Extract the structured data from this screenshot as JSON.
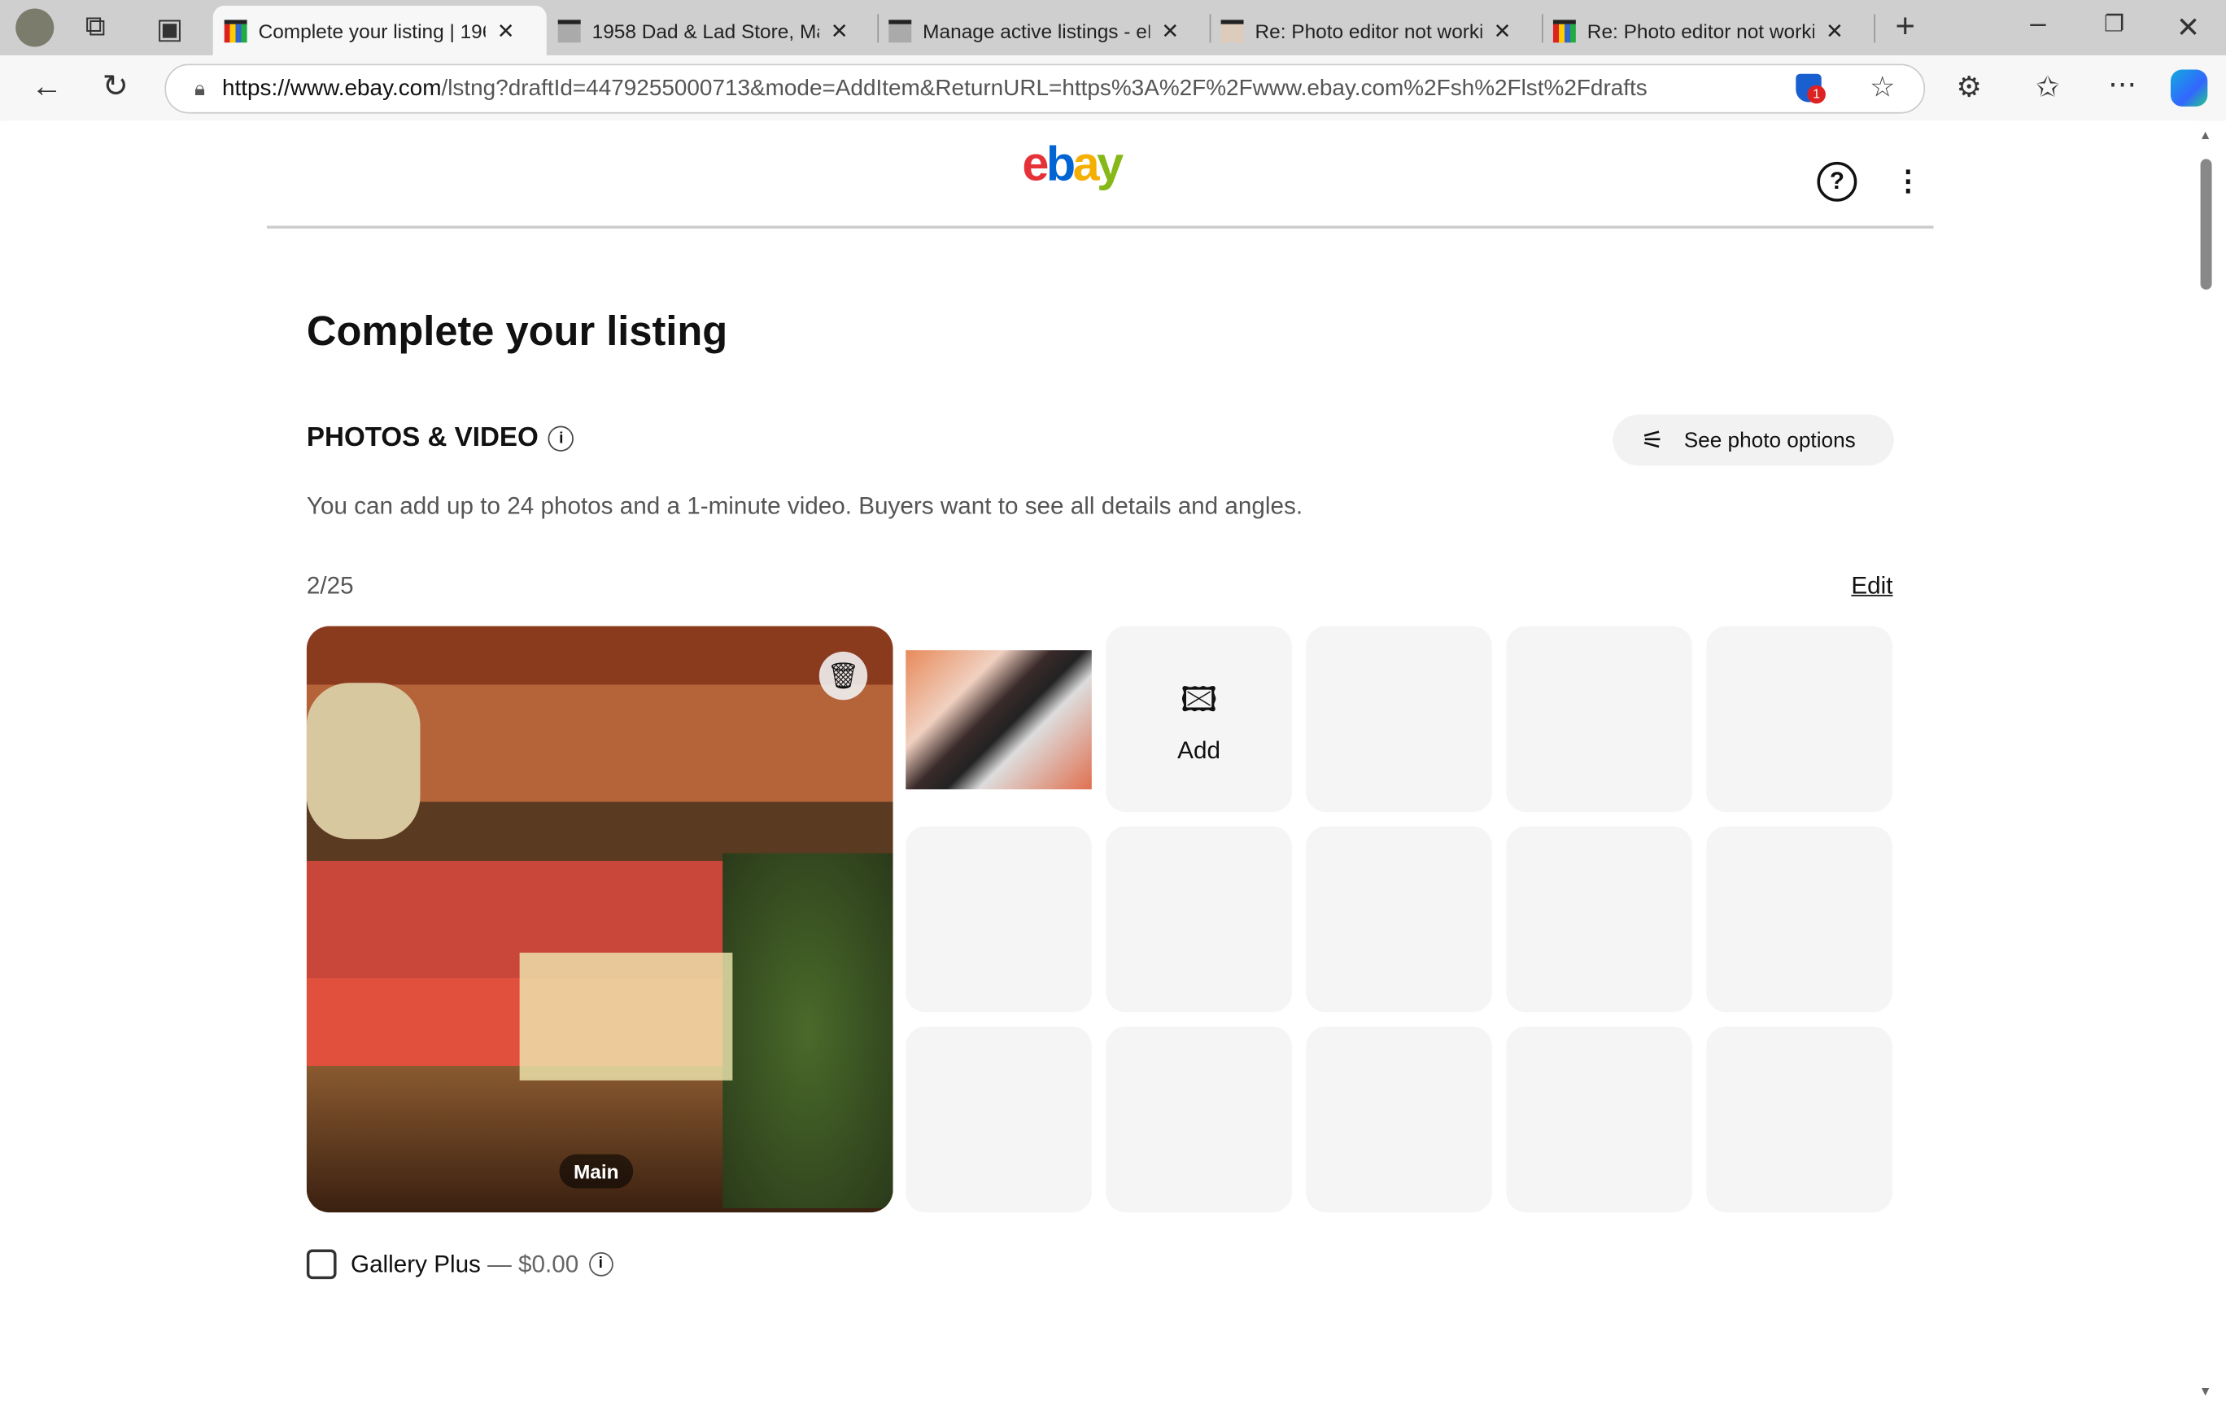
{
  "browser": {
    "tabs": [
      {
        "title": "Complete your listing | 196",
        "active": true
      },
      {
        "title": "1958 Dad & Lad Store, Mai",
        "active": false
      },
      {
        "title": "Manage active listings - eB",
        "active": false
      },
      {
        "title": "Re: Photo editor not workin",
        "active": false
      },
      {
        "title": "Re: Photo editor not workin",
        "active": false
      }
    ],
    "url_host": "https://www.ebay.com",
    "url_rest": "/lstng?draftId=4479255000713&mode=AddItem&ReturnURL=https%3A%2F%2Fwww.ebay.com%2Fsh%2Flst%2Fdrafts",
    "shield_badge": "1"
  },
  "header": {
    "logo": "ebay",
    "logo_colors": [
      "#e53238",
      "#0064d2",
      "#f5af02",
      "#86b817"
    ]
  },
  "main": {
    "title": "Complete your listing",
    "section_title": "PHOTOS & VIDEO",
    "photo_options": "See photo options",
    "description": "You can add up to 24 photos and a 1-minute video. Buyers want to see all details and angles.",
    "count": "2/25",
    "edit": "Edit",
    "main_badge": "Main",
    "add_label": "Add",
    "gallery_plus": "Gallery Plus",
    "gallery_price": "— $0.00"
  }
}
